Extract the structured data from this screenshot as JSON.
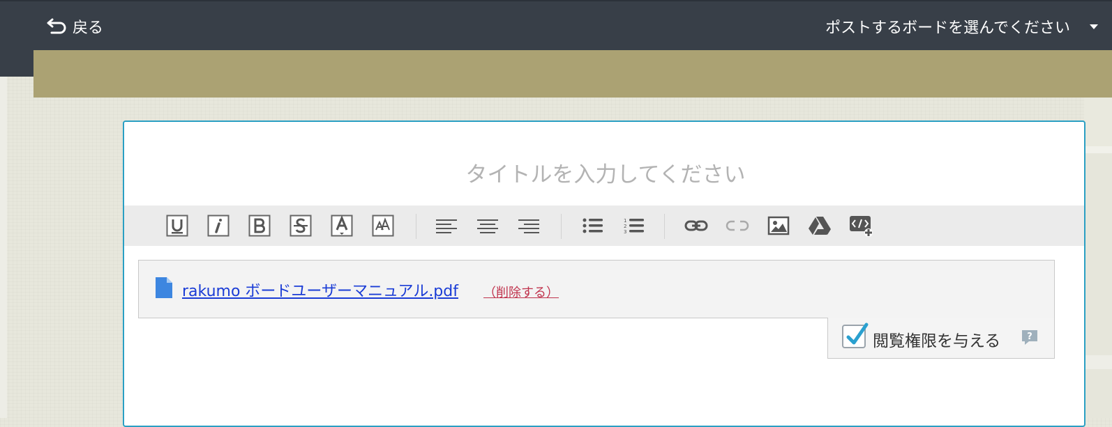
{
  "topbar": {
    "back_label": "戻る",
    "board_select_label": "ポストするボードを選んでください"
  },
  "editor": {
    "title_placeholder": "タイトルを入力してください",
    "toolbar": {
      "groups": [
        [
          "underline",
          "italic",
          "bold",
          "strikethrough",
          "font-color",
          "font-size"
        ],
        [
          "align-left",
          "align-center",
          "align-right"
        ],
        [
          "bulleted-list",
          "numbered-list"
        ],
        [
          "link",
          "unlink",
          "image",
          "google-drive",
          "embed-code"
        ]
      ]
    }
  },
  "attachment": {
    "file_name": "rakumo ボードユーザーマニュアル.pdf",
    "delete_label": "（削除する）"
  },
  "permission": {
    "label": "閲覧権限を与える",
    "checked": true
  },
  "colors": {
    "topbar": "#383f48",
    "banner": "#aba273",
    "card_border": "#2a9fc3",
    "link": "#1a3cd6",
    "delete": "#c0334d",
    "file_icon": "#3d86e0",
    "check": "#2aa0cf"
  }
}
